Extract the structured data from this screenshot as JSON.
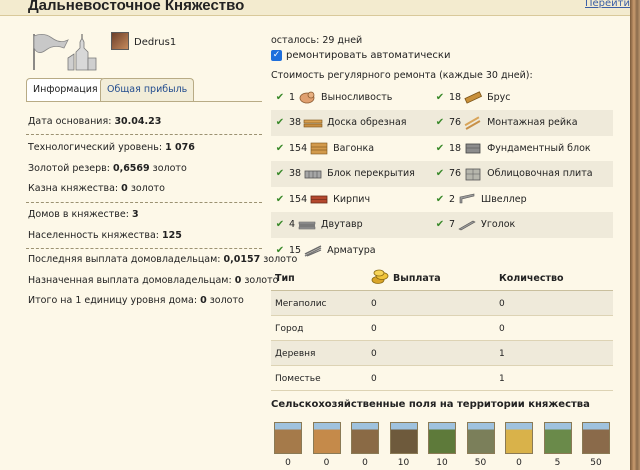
{
  "header": {
    "title": "Дальневосточное Княжество",
    "link": "Перейти"
  },
  "user": {
    "name": "Dedrus1"
  },
  "tabs": [
    {
      "label": "Информация",
      "active": true
    },
    {
      "label": "Общая прибыль",
      "active": false
    }
  ],
  "info": {
    "founded_label": "Дата основания:",
    "founded": "30.04.23",
    "tech_label": "Технологический уровень:",
    "tech": "1 076",
    "gold_label": "Золотой резерв:",
    "gold": "0,6569",
    "gold_unit": "золото",
    "treasury_label": "Казна княжества:",
    "treasury": "0",
    "treasury_unit": "золото",
    "houses_label": "Домов в княжестве:",
    "houses": "3",
    "population_label": "Населенность княжества:",
    "population": "125",
    "last_payout_label": "Последняя выплата домовладельцам:",
    "last_payout": "0,0157",
    "last_payout_unit": "золото",
    "next_payout_label": "Назначенная выплата домовладельцам:",
    "next_payout": "0",
    "next_payout_unit": "золото",
    "per_unit_label": "Итого на 1 единицу уровня дома:",
    "per_unit": "0",
    "per_unit_unit": "золото"
  },
  "repair": {
    "remaining": "осталось: 29 дней",
    "auto_label": "ремонтировать автоматически",
    "auto_checked": true,
    "title": "Стоимость регулярного ремонта (каждые 30 дней):",
    "rows": [
      {
        "left": {
          "qty": "1",
          "name": "Выносливость",
          "icon": "muscle-icon"
        },
        "right": {
          "qty": "18",
          "name": "Брус",
          "icon": "timber-icon"
        }
      },
      {
        "left": {
          "qty": "38",
          "name": "Доска обрезная",
          "icon": "plank-icon"
        },
        "right": {
          "qty": "76",
          "name": "Монтажная рейка",
          "icon": "rail-icon"
        }
      },
      {
        "left": {
          "qty": "154",
          "name": "Вагонка",
          "icon": "lining-icon"
        },
        "right": {
          "qty": "18",
          "name": "Фундаментный блок",
          "icon": "foundation-block-icon"
        }
      },
      {
        "left": {
          "qty": "38",
          "name": "Блок перекрытия",
          "icon": "floor-block-icon"
        },
        "right": {
          "qty": "76",
          "name": "Облицовочная плита",
          "icon": "facing-tile-icon"
        }
      },
      {
        "left": {
          "qty": "154",
          "name": "Кирпич",
          "icon": "brick-icon"
        },
        "right": {
          "qty": "2",
          "name": "Швеллер",
          "icon": "channel-icon"
        }
      },
      {
        "left": {
          "qty": "4",
          "name": "Двутавр",
          "icon": "i-beam-icon"
        },
        "right": {
          "qty": "7",
          "name": "Уголок",
          "icon": "angle-icon"
        }
      },
      {
        "left": {
          "qty": "15",
          "name": "Арматура",
          "icon": "rebar-icon"
        },
        "right": null
      }
    ]
  },
  "table": {
    "headers": {
      "type": "Тип",
      "payout": "Выплата",
      "qty": "Количество"
    },
    "rows": [
      {
        "type": "Мегаполис",
        "payout": "0",
        "qty": "0"
      },
      {
        "type": "Город",
        "payout": "0",
        "qty": "0"
      },
      {
        "type": "Деревня",
        "payout": "0",
        "qty": "1"
      },
      {
        "type": "Поместье",
        "payout": "0",
        "qty": "1"
      }
    ]
  },
  "fields": {
    "title": "Сельскохозяйственные поля на территории княжества",
    "items": [
      {
        "value": "0",
        "color": "#a57a4a"
      },
      {
        "value": "0",
        "color": "#c58a4a"
      },
      {
        "value": "0",
        "color": "#8a6a45"
      },
      {
        "value": "10",
        "color": "#6e5a3c"
      },
      {
        "value": "10",
        "color": "#5e7a3a"
      },
      {
        "value": "50",
        "color": "#7b7f5a"
      },
      {
        "value": "0",
        "color": "#d9b24a"
      },
      {
        "value": "5",
        "color": "#6a8a4a"
      },
      {
        "value": "50",
        "color": "#8a6a4a"
      }
    ]
  }
}
